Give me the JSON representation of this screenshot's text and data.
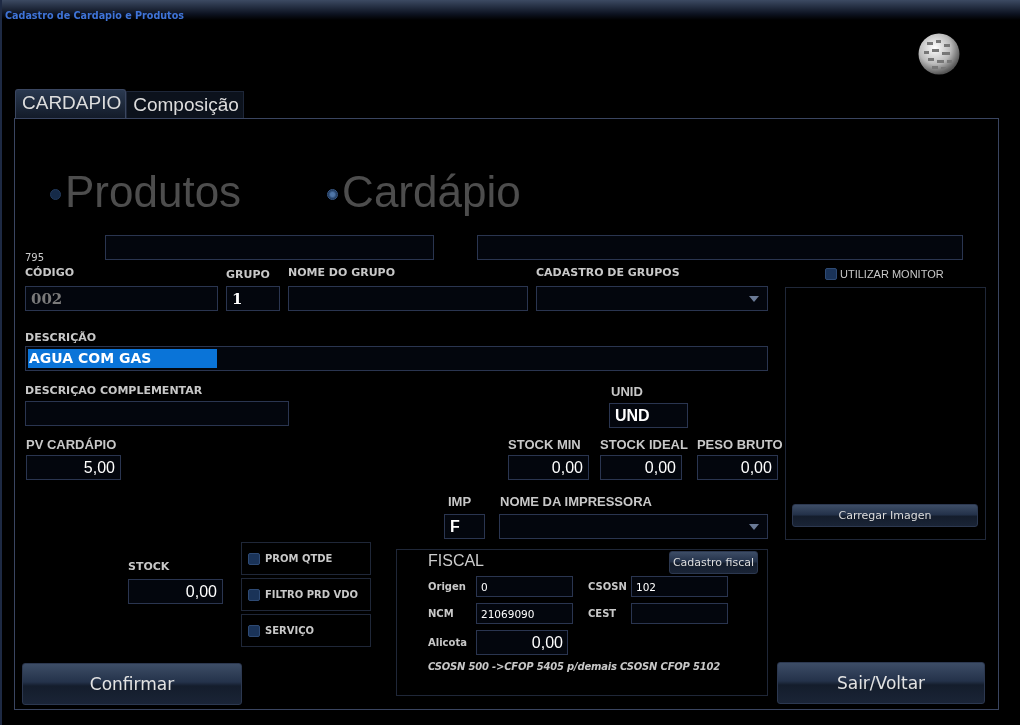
{
  "window": {
    "title": "Cadastro de Cardapio e Produtos"
  },
  "tabs": [
    {
      "label": "CARDAPIO",
      "selected": true
    },
    {
      "label": "Composição",
      "selected": false
    }
  ],
  "mode_options": [
    {
      "label": "Produtos",
      "selected": false
    },
    {
      "label": "Cardápio",
      "selected": true
    }
  ],
  "record_number": "795",
  "form": {
    "codigo": {
      "label": "CÓDIGO",
      "value": "002",
      "disabled": true
    },
    "grupo": {
      "label": "GRUPO",
      "value": "1"
    },
    "nome_do_grupo": {
      "label": "NOME DO GRUPO"
    },
    "cadastro_de_grupos": {
      "label": "CADASTRO DE GRUPOS"
    },
    "descricao": {
      "label": "DESCRIÇÃO",
      "value": "AGUA COM GAS",
      "selected": true
    },
    "descricao_complementar": {
      "label": "DESCRIÇAO COMPLEMENTAR"
    },
    "unid": {
      "label": "UNID",
      "value": "UND"
    },
    "pv_cardapio": {
      "label": "PV CARDÁPIO",
      "value": "5,00"
    },
    "stock_min": {
      "label": "STOCK MIN",
      "value": "0,00"
    },
    "stock_ideal": {
      "label": "STOCK IDEAL",
      "value": "0,00"
    },
    "peso_bruto": {
      "label": "PESO BRUTO",
      "value": "0,00"
    },
    "imp": {
      "label": "IMP",
      "value": "F"
    },
    "nome_da_impressora": {
      "label": "NOME DA IMPRESSORA"
    },
    "stock": {
      "label": "STOCK",
      "value": "0,00"
    }
  },
  "options": [
    {
      "label": "PROM QTDE",
      "checked": false
    },
    {
      "label": "FILTRO PRD VDO",
      "checked": false
    },
    {
      "label": "SERVIÇO",
      "checked": false
    }
  ],
  "monitor": {
    "label": "UTILIZAR MONITOR",
    "checked": false
  },
  "image_button": {
    "label": "Carregar Imagen"
  },
  "fiscal": {
    "title": "FISCAL",
    "button": {
      "label": "Cadastro fiscal"
    },
    "origen": {
      "label": "Origen",
      "value": "0"
    },
    "csosn": {
      "label": "CSOSN",
      "value": "102"
    },
    "ncm": {
      "label": "NCM",
      "value": "21069090"
    },
    "cest": {
      "label": "CEST"
    },
    "alicota": {
      "label": "Alicota",
      "value": "0,00"
    },
    "note": "CSOSN 500 ->CFOP 5405 p/demais CSOSN CFOP 5102"
  },
  "buttons": {
    "confirm": {
      "label": "Confirmar"
    },
    "exit": {
      "label": "Sair/Voltar"
    }
  }
}
